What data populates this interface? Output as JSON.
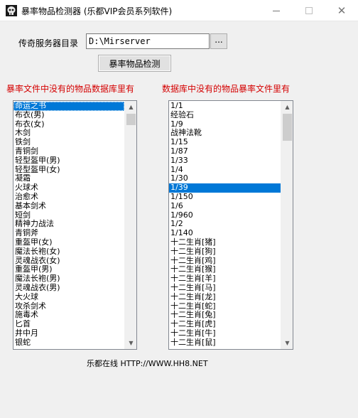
{
  "window": {
    "title": "暴率物品检测器 (乐都VIP会员系列软件)",
    "icon": "skull-app-icon"
  },
  "directory": {
    "label": "传奇服务器目录",
    "value": "D:\\Mirserver",
    "browse_label": "..."
  },
  "check_button": {
    "label": "暴率物品检测"
  },
  "left_panel": {
    "label": "暴率文件中没有的物品数据库里有",
    "selected_index": 0,
    "items": [
      "命运之书",
      "布衣(男)",
      "布衣(女)",
      "木剑",
      "铁剑",
      "青铜剑",
      "轻型盔甲(男)",
      "轻型盔甲(女)",
      "凝霜",
      "火球术",
      "治愈术",
      "基本剑术",
      "短剑",
      "精神力战法",
      "青铜斧",
      "重盔甲(女)",
      "魔法长袍(女)",
      "灵魂战衣(女)",
      "重盔甲(男)",
      "魔法长袍(男)",
      "灵魂战衣(男)",
      "大火球",
      "攻杀剑术",
      "施毒术",
      "匕首",
      "井中月",
      "银蛇"
    ]
  },
  "right_panel": {
    "label": "数据库中没有的物品暴率文件里有",
    "selected_index": 9,
    "items": [
      "1/1",
      "经验石",
      "1/9",
      "战神法靴",
      "1/15",
      "1/87",
      "1/33",
      "1/4",
      "1/30",
      "1/39",
      "1/150",
      "1/6",
      "1/960",
      "1/2",
      "1/140",
      "十二生肖[猪]",
      "十二生肖[狗]",
      "十二生肖[鸡]",
      "十二生肖[猴]",
      "十二生肖[羊]",
      "十二生肖[马]",
      "十二生肖[龙]",
      "十二生肖[蛇]",
      "十二生肖[兔]",
      "十二生肖[虎]",
      "十二生肖[牛]",
      "十二生肖[鼠]"
    ]
  },
  "footer": {
    "text": "乐都在线 HTTP://WWW.HH8.NET"
  },
  "colors": {
    "section_label": "#d40000",
    "selection": "#0078d7"
  }
}
